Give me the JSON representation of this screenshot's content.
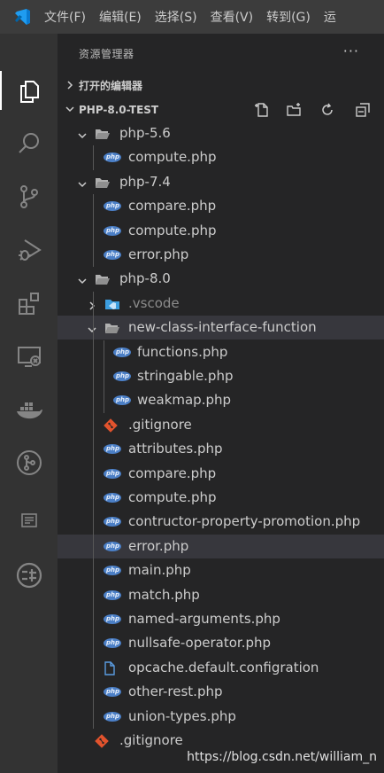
{
  "menubar": {
    "items": [
      "文件(F)",
      "编辑(E)",
      "选择(S)",
      "查看(V)",
      "转到(G)",
      "运"
    ]
  },
  "activity_bar": {
    "icons": [
      "explorer-icon",
      "search-icon",
      "source-control-icon",
      "run-debug-icon",
      "extensions-icon",
      "remote-explorer-icon",
      "docker-icon",
      "gitlens-icon",
      "output-icon",
      "php-namespace-icon"
    ]
  },
  "sidebar": {
    "title": "资源管理器",
    "more_label": "···",
    "open_editors": "打开的编辑器",
    "workspace": "PHP-8.0-TEST"
  },
  "tree": {
    "php56": {
      "name": "php-5.6",
      "files": [
        "compute.php"
      ]
    },
    "php74": {
      "name": "php-7.4",
      "files": [
        "compare.php",
        "compute.php",
        "error.php"
      ]
    },
    "php80": {
      "name": "php-8.0",
      "vscode": ".vscode",
      "ncif": {
        "name": "new-class-interface-function",
        "files": [
          "functions.php",
          "stringable.php",
          "weakmap.php"
        ]
      },
      "gitignore": ".gitignore",
      "files": [
        "attributes.php",
        "compare.php",
        "compute.php",
        "contructor-property-promotion.php",
        "error.php",
        "main.php",
        "match.php",
        "named-arguments.php",
        "nullsafe-operator.php",
        "opcache.default.configration",
        "other-rest.php",
        "union-types.php"
      ]
    },
    "root_gitignore": ".gitignore"
  },
  "watermark": "https://blog.csdn.net/william_n",
  "colors": {
    "titlebar": "#3c3c3c",
    "activity": "#333333",
    "sidebar": "#252526",
    "selection": "#37373d",
    "accent": "#007acc",
    "php": "#4b7fc6",
    "git": "#e2532d"
  }
}
